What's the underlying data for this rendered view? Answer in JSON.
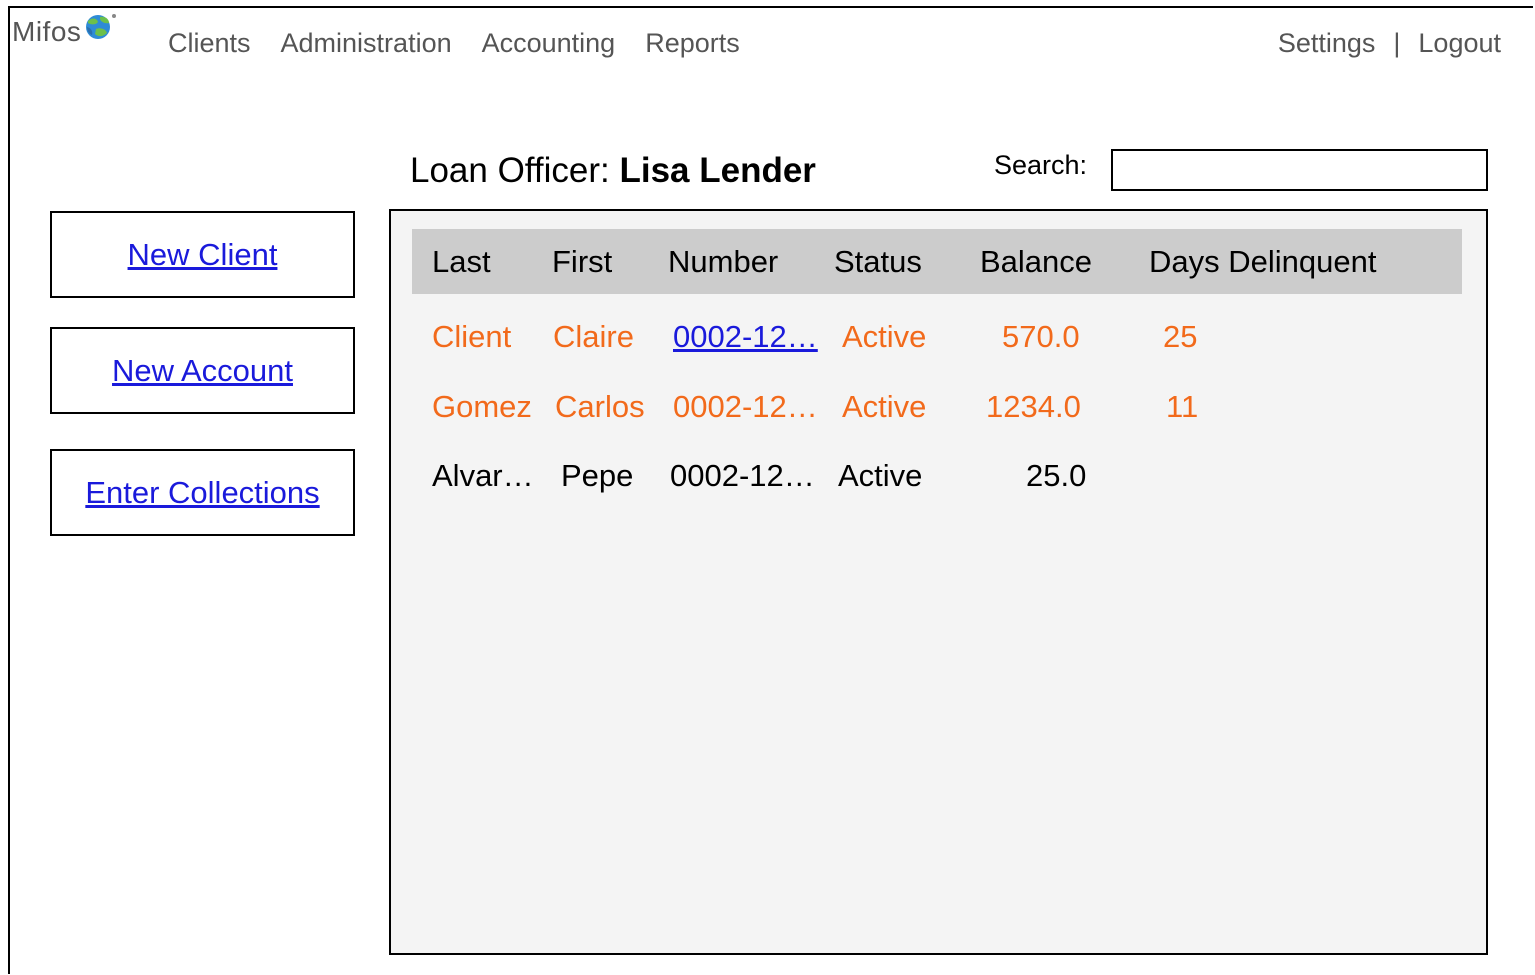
{
  "app": {
    "logo_text": "Mifos"
  },
  "nav": {
    "items": [
      "Clients",
      "Administration",
      "Accounting",
      "Reports"
    ],
    "settings": "Settings",
    "separator": "|",
    "logout": "Logout"
  },
  "header": {
    "officer_label": "Loan Officer:",
    "officer_name": "Lisa Lender",
    "search_label": "Search:",
    "search_value": ""
  },
  "sidebar": {
    "buttons": [
      "New Client",
      "New Account",
      "Enter Collections"
    ]
  },
  "table": {
    "columns": [
      "Last",
      "First",
      "Number",
      "Status",
      "Balance",
      "Days Delinquent"
    ],
    "rows": [
      {
        "last": "Client",
        "first": "Claire",
        "number": "0002-12… ",
        "status": "Active",
        "balance": "570.0",
        "days": "25",
        "highlight": true
      },
      {
        "last": "Gomez",
        "first": "Carlos",
        "number": "0002-12…",
        "status": "Active",
        "balance": "1234.0",
        "days": "11",
        "highlight": true
      },
      {
        "last": "Alvar…",
        "first": "Pepe",
        "number": "0002-12…",
        "status": "Active",
        "balance": "25.0",
        "days": "",
        "highlight": false
      }
    ]
  },
  "colors": {
    "delinquent": "#f26a1b",
    "link": "#1a1adb",
    "header_bg": "#cccccc",
    "panel_bg": "#f4f4f4",
    "nav_text": "#555555"
  }
}
